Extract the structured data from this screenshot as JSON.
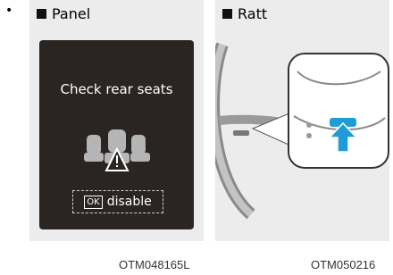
{
  "bullet": "•",
  "panels": [
    {
      "label": "Panel"
    },
    {
      "label": "Ratt"
    }
  ],
  "display": {
    "message": "Check rear seats",
    "ok_key": "OK",
    "disable_label": "disable"
  },
  "captions": [
    "OTM048165L",
    "OTM050216"
  ],
  "colors": {
    "panel_bg": "#ececec",
    "screen_bg": "#2a2422",
    "arrow": "#1f9cd6"
  },
  "icons": [
    "seat-warning-icon",
    "steering-wheel-illustration",
    "up-arrow-icon"
  ]
}
